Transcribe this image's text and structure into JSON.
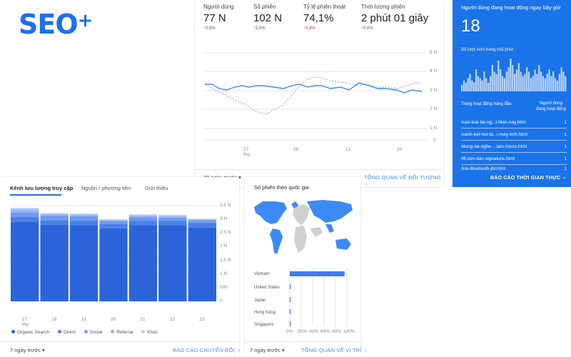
{
  "logo": {
    "text": "SEO",
    "plus": "+"
  },
  "overview": {
    "metrics": [
      {
        "label": "Người dùng",
        "value": "77 N",
        "delta": "5,6%",
        "dir": "up"
      },
      {
        "label": "Số phiên",
        "value": "102 N",
        "delta": "5,5%",
        "dir": "up"
      },
      {
        "label": "Tỷ lệ phiên thoát",
        "value": "74,1%",
        "delta": "0,4%",
        "dir": "down"
      },
      {
        "label": "Thời lượng phiên",
        "value": "2 phút 01 giây",
        "delta": "0,0%",
        "dir": "up"
      }
    ],
    "up_arrow": "↑",
    "down_arrow": "↑",
    "y_ticks": [
      "5 N",
      "4 N",
      "3 N",
      "2 N",
      "1 N",
      "0"
    ],
    "x_ticks": [
      "27",
      "06",
      "13",
      "20"
    ],
    "x_sub": "thg",
    "date_range": "30 ngày trước",
    "link": "TỔNG QUAN VỀ ĐỐI TƯỢNG",
    "colors": {
      "line": "#4285f4",
      "dashed": "#8ab4f8"
    }
  },
  "realtime": {
    "title": "Người dùng đang hoạt động ngay bây giờ",
    "value": "18",
    "subtitle": "Số lượt xem trang mỗi phút",
    "table_header_page": "Trang hoạt động hàng đầu",
    "table_header_users": "Người dùng đang hoạt động",
    "rows": [
      {
        "page": "/cao-loai-tai-ng...t-hien-nay.html",
        "count": "1"
      },
      {
        "page": "/cach-ket-noi-ta...i-may-tinh.html",
        "count": "1"
      },
      {
        "page": "/dung-tai-nghe-...lam-micro.html",
        "count": "1"
      },
      {
        "page": "/lfi-zen-dac-signature.html",
        "count": "1"
      },
      {
        "page": "/loa-bluetooth-jbl.html",
        "count": "1"
      }
    ],
    "link": "BÁO CÁO THỜI GIAN THỰC",
    "bars": [
      3,
      5,
      4,
      6,
      8,
      5,
      4,
      10,
      7,
      6,
      5,
      9,
      6,
      4,
      7,
      12,
      9,
      8,
      14,
      10,
      7,
      6,
      9,
      11,
      15,
      12,
      8,
      10,
      13,
      9,
      7,
      8,
      11,
      9,
      6,
      7,
      10,
      8,
      12,
      9,
      7,
      6,
      8,
      10,
      7,
      9,
      6,
      5,
      8,
      11,
      9,
      7
    ],
    "color": "#1a73e8"
  },
  "channels": {
    "tabs": [
      "Kênh lưu lượng truy cập",
      "Nguồn / phương tiện",
      "Giới thiệu"
    ],
    "y_ticks": [
      "3,5 N",
      "3 N",
      "2,5 N",
      "2 N",
      "1,5 N",
      "1 N",
      "500",
      "0"
    ],
    "days": [
      "17",
      "18",
      "19",
      "20",
      "21",
      "22",
      "23"
    ],
    "x_sub": "thg",
    "legend": [
      {
        "name": "Organic Search",
        "color": "#2b64d8"
      },
      {
        "name": "Direct",
        "color": "#4a80e8"
      },
      {
        "name": "Social",
        "color": "#6f9bf0"
      },
      {
        "name": "Referral",
        "color": "#94b6f5"
      },
      {
        "name": "Khác",
        "color": "#bcd1f7"
      }
    ],
    "date_range": "7 ngày trước",
    "link": "BÁO CÁO CHUYỂN ĐỔI",
    "chart_data": {
      "type": "bar",
      "stacked": true,
      "categories": [
        "17",
        "18",
        "19",
        "20",
        "21",
        "22",
        "23"
      ],
      "ylim": [
        0,
        3500
      ],
      "series": [
        {
          "name": "Organic Search",
          "values": [
            2900,
            2800,
            2780,
            2670,
            2780,
            2780,
            2700
          ]
        },
        {
          "name": "Direct",
          "values": [
            180,
            170,
            170,
            170,
            170,
            170,
            170
          ]
        },
        {
          "name": "Social",
          "values": [
            180,
            160,
            160,
            100,
            130,
            110,
            100
          ]
        },
        {
          "name": "Referral",
          "values": [
            100,
            60,
            60,
            30,
            60,
            60,
            30
          ]
        },
        {
          "name": "Khác",
          "values": [
            60,
            40,
            40,
            20,
            40,
            40,
            20
          ]
        }
      ]
    }
  },
  "geo": {
    "title": "Số phiên theo quốc gia",
    "countries": [
      "Vietnam",
      "United States",
      "Japan",
      "Hong Kong",
      "Singapore"
    ],
    "x_ticks": [
      "0%",
      "20%",
      "40%",
      "60%",
      "80%",
      "100%"
    ],
    "date_range": "7 ngày trước",
    "link": "TỔNG QUAN VỀ VỊ TRÍ",
    "chart_data": {
      "type": "bar",
      "orientation": "horizontal",
      "categories": [
        "Vietnam",
        "United States",
        "Japan",
        "Hong Kong",
        "Singapore"
      ],
      "values": [
        96,
        1.5,
        1,
        0.5,
        0.5
      ],
      "xlim": [
        0,
        100
      ]
    }
  }
}
